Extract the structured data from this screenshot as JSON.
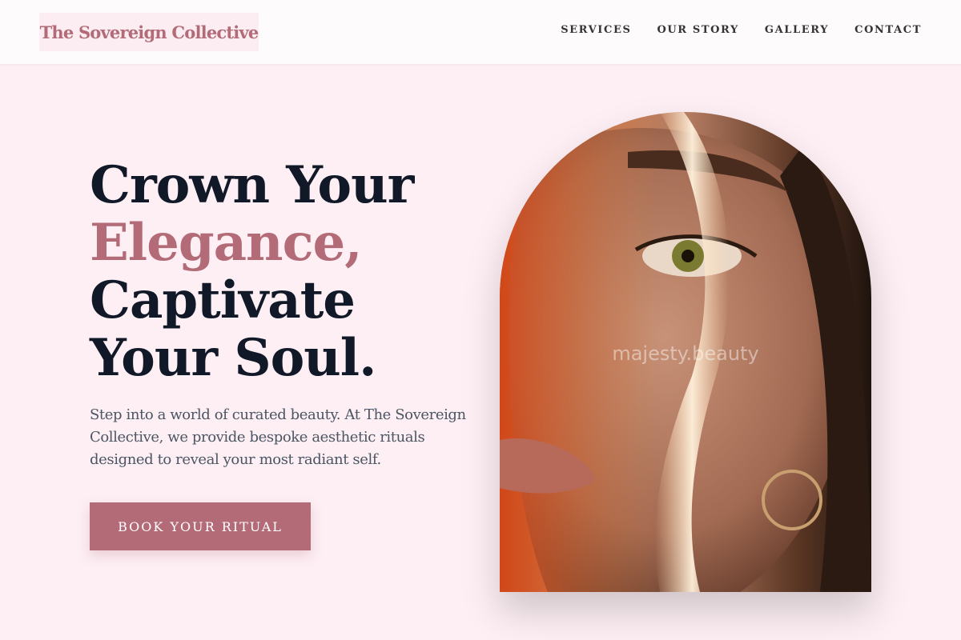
{
  "header": {
    "logo": "The Sovereign Collective",
    "nav": [
      "SERVICES",
      "OUR STORY",
      "GALLERY",
      "CONTACT"
    ]
  },
  "hero": {
    "title_line1": "Crown Your",
    "title_line2": "Elegance,",
    "title_line3": "Captivate",
    "title_line4": "Your Soul.",
    "description": "Step into a world of curated beauty. At The Sovereign Collective, we provide bespoke aesthetic rituals designed to reveal your most radiant self.",
    "cta": "BOOK YOUR RITUAL"
  },
  "portrait": {
    "watermark": "majesty.beauty",
    "icon": "portrait-image"
  },
  "colors": {
    "background": "#fdeff4",
    "header_bg": "#fefbfc",
    "accent": "#b36b77",
    "heading": "#111827",
    "body_text": "#4b5563"
  }
}
